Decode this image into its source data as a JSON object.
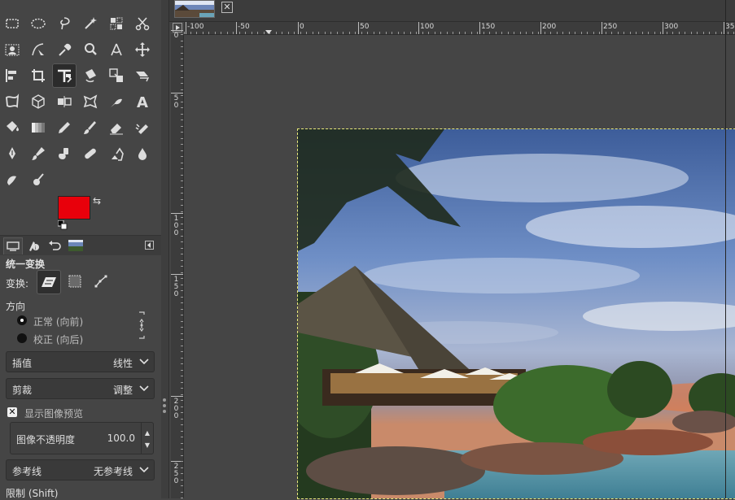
{
  "toolbox": {
    "tools": [
      {
        "name": "rect-select-icon",
        "glyph": "rect"
      },
      {
        "name": "ellipse-select-icon",
        "glyph": "ellipse"
      },
      {
        "name": "free-select-icon",
        "glyph": "lasso"
      },
      {
        "name": "fuzzy-select-icon",
        "glyph": "wand"
      },
      {
        "name": "select-by-color-icon",
        "glyph": "colorsel"
      },
      {
        "name": "scissors-select-icon",
        "glyph": "scissors"
      },
      {
        "name": "foreground-select-icon",
        "glyph": "fgsel"
      },
      {
        "name": "paths-icon",
        "glyph": "paths"
      },
      {
        "name": "color-picker-icon",
        "glyph": "picker"
      },
      {
        "name": "zoom-icon",
        "glyph": "zoom"
      },
      {
        "name": "measure-icon",
        "glyph": "measure"
      },
      {
        "name": "move-icon",
        "glyph": "move"
      },
      {
        "name": "align-icon",
        "glyph": "align"
      },
      {
        "name": "crop-icon",
        "glyph": "crop"
      },
      {
        "name": "unified-transform-icon",
        "glyph": "unified"
      },
      {
        "name": "rotate-icon",
        "glyph": "rotate"
      },
      {
        "name": "scale-icon",
        "glyph": "scale"
      },
      {
        "name": "shear-icon",
        "glyph": "shear"
      },
      {
        "name": "warp-transform-icon",
        "glyph": "warp"
      },
      {
        "name": "3d-transform-icon",
        "glyph": "cube"
      },
      {
        "name": "flip-icon",
        "glyph": "flip"
      },
      {
        "name": "cage-transform-icon",
        "glyph": "cage"
      },
      {
        "name": "smudge-warp-icon",
        "glyph": "iwarp"
      },
      {
        "name": "text-icon",
        "glyph": "text"
      },
      {
        "name": "bucket-fill-icon",
        "glyph": "bucket"
      },
      {
        "name": "gradient-icon",
        "glyph": "gradient"
      },
      {
        "name": "pencil-icon",
        "glyph": "pencil"
      },
      {
        "name": "paintbrush-icon",
        "glyph": "brush"
      },
      {
        "name": "eraser-icon",
        "glyph": "eraser"
      },
      {
        "name": "airbrush-icon",
        "glyph": "airbrush"
      },
      {
        "name": "ink-icon",
        "glyph": "ink"
      },
      {
        "name": "mypaint-brush-icon",
        "glyph": "mypaint"
      },
      {
        "name": "clone-icon",
        "glyph": "clone"
      },
      {
        "name": "heal-icon",
        "glyph": "heal"
      },
      {
        "name": "perspective-clone-icon",
        "glyph": "pclone"
      },
      {
        "name": "blur-icon",
        "glyph": "blur"
      },
      {
        "name": "smudge-icon",
        "glyph": "smudge"
      },
      {
        "name": "dodge-burn-icon",
        "glyph": "dodge"
      }
    ],
    "active_tool": "unified-transform-icon",
    "fg_color": "#e8000b",
    "bg_color": "#ffffff"
  },
  "tool_options": {
    "title": "统一变换",
    "transform_label": "变换:",
    "direction_label": "方向",
    "direction_normal": "正常 (向前)",
    "direction_corrective": "校正 (向后)",
    "interpolation_label": "插值",
    "interpolation_value": "线性",
    "clipping_label": "剪裁",
    "clipping_value": "调整",
    "show_preview_label": "显示图像预览",
    "show_preview_checked": true,
    "opacity_label": "图像不透明度",
    "opacity_value": "100.0",
    "guides_label": "参考线",
    "guides_value": "无参考线",
    "constrain_label": "限制 (Shift)"
  },
  "rulers": {
    "h_labels": [
      "-100",
      "-50",
      "0",
      "50",
      "100",
      "150",
      "200",
      "250",
      "300",
      "35"
    ],
    "v_labels": [
      "0",
      "5 0",
      "1 0 0",
      "1 5 0",
      "2 0 0",
      "2 5 0"
    ]
  }
}
